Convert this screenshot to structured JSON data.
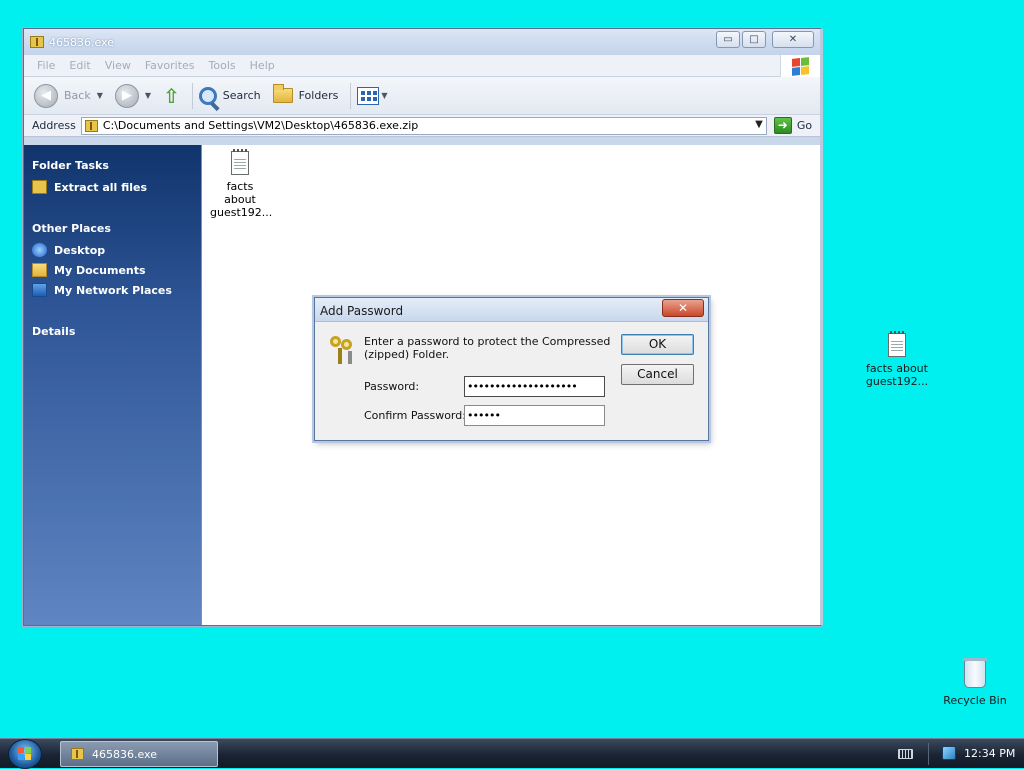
{
  "window": {
    "title": "465836.exe",
    "controls": {
      "minimize": "▭",
      "maximize": "□",
      "close": "✕"
    },
    "menu": [
      "File",
      "Edit",
      "View",
      "Favorites",
      "Tools",
      "Help"
    ],
    "toolbar": {
      "back_label": "Back",
      "search_label": "Search",
      "folders_label": "Folders"
    },
    "address": {
      "label": "Address",
      "value": "C:\\Documents and Settings\\VM2\\Desktop\\465836.exe.zip",
      "go_label": "Go"
    },
    "taskpane": {
      "folder_tasks": {
        "heading": "Folder Tasks",
        "items": [
          {
            "label": "Extract all files",
            "icon": "zip-folder-icon"
          }
        ]
      },
      "other_places": {
        "heading": "Other Places",
        "items": [
          {
            "label": "Desktop",
            "icon": "desktop-icon"
          },
          {
            "label": "My Documents",
            "icon": "my-documents-icon"
          },
          {
            "label": "My Network Places",
            "icon": "network-places-icon"
          }
        ]
      },
      "details": {
        "heading": "Details"
      }
    },
    "files": [
      {
        "label_line1": "facts about",
        "label_line2": "guest192...",
        "icon": "text-file-icon"
      }
    ]
  },
  "dialog": {
    "title": "Add Password",
    "close": "✕",
    "message": "Enter a password to protect the Compressed (zipped) Folder.",
    "password_label": "Password:",
    "password_value": "••••••••••••••••••••",
    "confirm_label": "Confirm Password:",
    "confirm_value": "••••••",
    "ok_label": "OK",
    "cancel_label": "Cancel"
  },
  "desktop": {
    "icons": [
      {
        "label_line1": "facts about",
        "label_line2": "guest192...",
        "icon": "text-file-icon"
      },
      {
        "label": "Recycle Bin",
        "icon": "recycle-bin-icon"
      }
    ]
  },
  "taskbar": {
    "task_label": "465836.exe",
    "clock": "12:34 PM"
  },
  "colors": {
    "desktop_bg": "#00f0f0",
    "taskpane_top": "#10346c",
    "taskpane_bottom": "#5f86c2"
  }
}
